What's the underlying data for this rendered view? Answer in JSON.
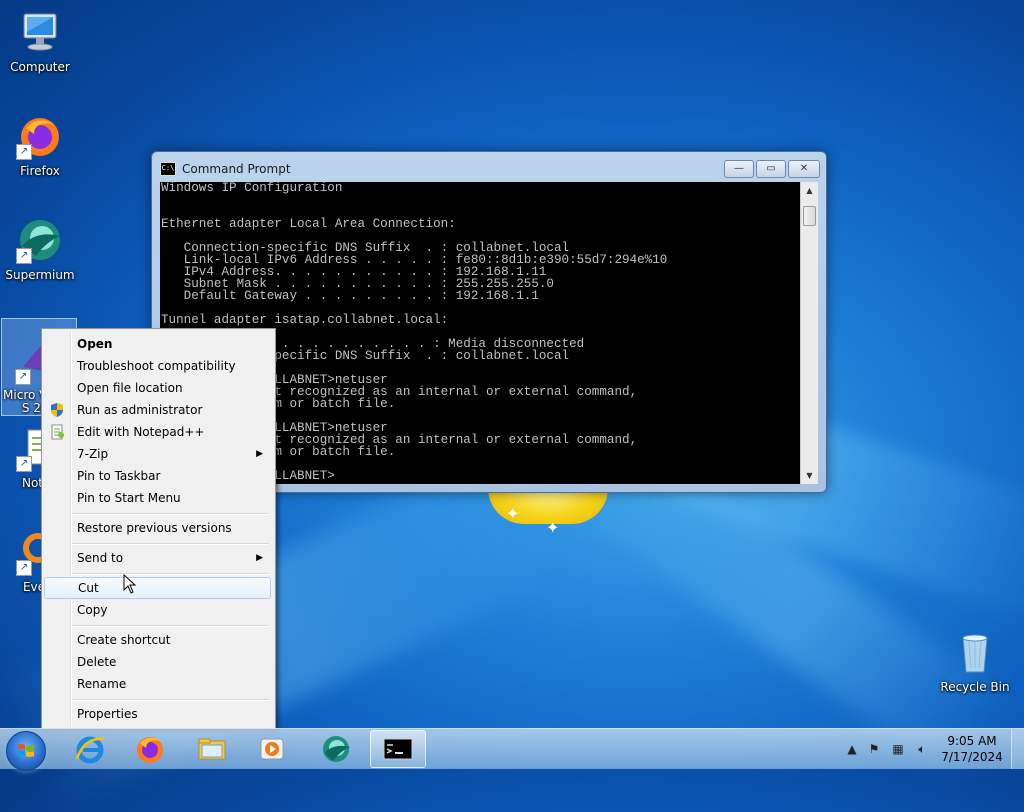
{
  "desktop": {
    "icons": [
      {
        "label": "Computer"
      },
      {
        "label": "Firefox"
      },
      {
        "label": "Supermium"
      },
      {
        "label": "Micro Visual S 201"
      },
      {
        "label": "Notep"
      },
      {
        "label": "Every"
      },
      {
        "label": "Recycle Bin"
      }
    ]
  },
  "cmd": {
    "title": "Command Prompt",
    "lines": "Windows IP Configuration\n\n\nEthernet adapter Local Area Connection:\n\n   Connection-specific DNS Suffix  . : collabnet.local\n   Link-local IPv6 Address . . . . . : fe80::8d1b:e390:55d7:294e%10\n   IPv4 Address. . . . . . . . . . . : 192.168.1.11\n   Subnet Mask . . . . . . . . . . . : 255.255.255.0\n   Default Gateway . . . . . . . . . : 192.168.1.1\n\nTunnel adapter isatap.collabnet.local:\n\n              . . . . . . . . . . . : Media disconnected\n              specific DNS Suffix  . : collabnet.local\n\n              OLLABNET>netuser\n              ot recognized as an internal or external command,\n              am or batch file.\n\n              OLLABNET>netuser\n              ot recognized as an internal or external command,\n              am or batch file.\n\n              OLLABNET>",
    "buttons": {
      "minimize": "—",
      "maximize": "▭",
      "close": "✕"
    }
  },
  "context_menu": {
    "items": [
      {
        "label": "Open"
      },
      {
        "label": "Troubleshoot compatibility"
      },
      {
        "label": "Open file location"
      },
      {
        "label": "Run as administrator"
      },
      {
        "label": "Edit with Notepad++"
      },
      {
        "label": "7-Zip"
      },
      {
        "label": "Pin to Taskbar"
      },
      {
        "label": "Pin to Start Menu"
      },
      {
        "label": "Restore previous versions"
      },
      {
        "label": "Send to"
      },
      {
        "label": "Cut"
      },
      {
        "label": "Copy"
      },
      {
        "label": "Create shortcut"
      },
      {
        "label": "Delete"
      },
      {
        "label": "Rename"
      },
      {
        "label": "Properties"
      }
    ]
  },
  "taskbar": {
    "pinned": [
      "start-icon",
      "internet-explorer-icon",
      "firefox-icon",
      "file-explorer-icon",
      "media-player-icon",
      "supermium-icon",
      "command-prompt-icon"
    ],
    "clock": {
      "time": "9:05 AM",
      "date": "7/17/2024"
    }
  },
  "colors": {
    "desktop_blue": "#0d5fbf",
    "menu_bg": "#f0f0f0",
    "menu_hover_border": "#aecff7"
  }
}
